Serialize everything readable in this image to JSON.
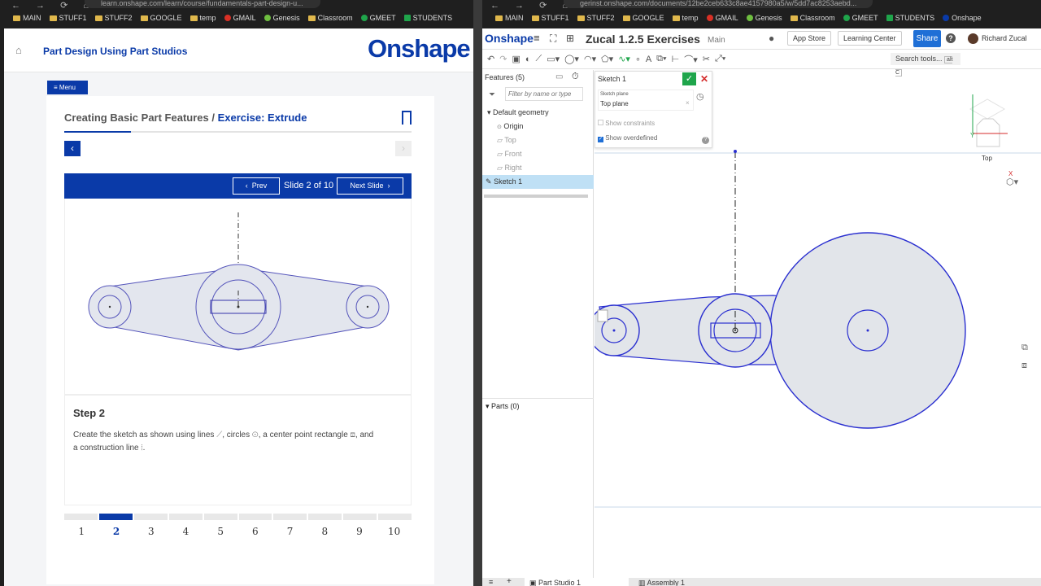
{
  "browser": {
    "left_url": "learn.onshape.com/learn/course/fundamentals-part-design-u...",
    "right_url": "gerinst.onshape.com/documents/12be2ceb633c8ae4157980a5/w/5dd7ac8253aebd...",
    "left_bookmarks": [
      "MAIN",
      "STUFF1",
      "STUFF2",
      "GOOGLE",
      "temp",
      "GMAIL",
      "Genesis",
      "Classroom",
      "GMEET",
      "STUDENTS"
    ],
    "right_bookmarks": [
      "MAIN",
      "STUFF1",
      "STUFF2",
      "GOOGLE",
      "temp",
      "GMAIL",
      "Genesis",
      "Classroom",
      "GMEET",
      "STUDENTS",
      "Onshape"
    ]
  },
  "learn": {
    "course_title": "Part Design Using Part Studios",
    "logo": "Onshape",
    "menu_label": "Menu",
    "breadcrumb_prefix": "Creating Basic Part Features /",
    "breadcrumb_current": "Exercise: Extrude",
    "prev_label": "Prev",
    "slide_label": "Slide 2 of 10",
    "next_label": "Next Slide",
    "step_title": "Step 2",
    "step_text_1": "Create the sketch as shown using lines",
    "step_text_2": ", circles",
    "step_text_3": ", a center point rectangle",
    "step_text_4": ", and",
    "step_text_5": "a construction line",
    "step_text_6": ".",
    "pages": [
      "1",
      "2",
      "3",
      "4",
      "5",
      "6",
      "7",
      "8",
      "9",
      "10"
    ],
    "active_page": 2
  },
  "onshape": {
    "logo": "Onshape",
    "doc_title": "Zucal 1.2.5 Exercises",
    "branch": "Main",
    "app_store": "App Store",
    "learning_center": "Learning Center",
    "share": "Share",
    "help": "?",
    "user": "Richard Zucal",
    "search_tools": "Search tools...",
    "search_shortcut": "alt C",
    "features_label": "Features (5)",
    "filter_placeholder": "Filter by name or type",
    "tree": [
      "Default geometry",
      "Origin",
      "Top",
      "Front",
      "Right",
      "Sketch 1"
    ],
    "parts_label": "Parts (0)",
    "sketch_name": "Sketch 1",
    "sketch_plane_label": "Sketch plane",
    "sketch_plane_value": "Top plane",
    "show_constraints": "Show constraints",
    "show_overdefined": "Show overdefined",
    "view_cube_label": "Top",
    "axis_y": "Y",
    "axis_x": "X",
    "tab_part_studio": "Part Studio 1",
    "tab_assembly": "Assembly 1"
  },
  "colors": {
    "brand": "#0a3aa8",
    "sketch_line": "#2a2fd0",
    "sketch_fill": "#e2e5ea",
    "selected_row": "#bfe0f5",
    "ok_green": "#1fa54b",
    "cancel_red": "#d42b2b"
  }
}
